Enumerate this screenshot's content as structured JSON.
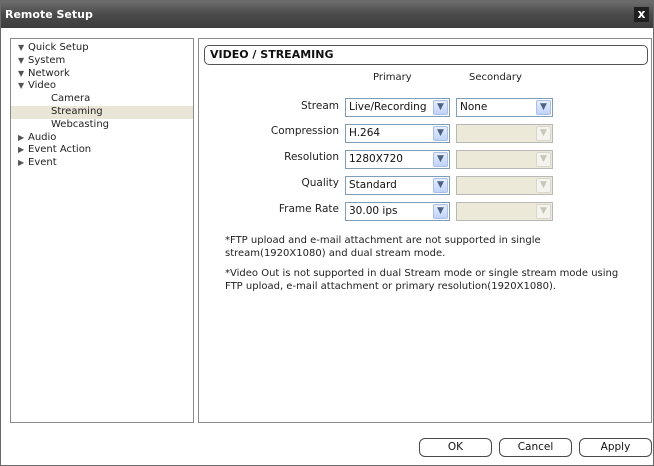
{
  "window": {
    "title": "Remote Setup",
    "close_glyph": "x"
  },
  "tree": {
    "items": [
      {
        "label": "Quick Setup",
        "state": "expanded"
      },
      {
        "label": "System",
        "state": "expanded"
      },
      {
        "label": "Network",
        "state": "expanded"
      },
      {
        "label": "Video",
        "state": "expanded"
      },
      {
        "label": "Camera",
        "state": "child"
      },
      {
        "label": "Streaming",
        "state": "child-selected"
      },
      {
        "label": "Webcasting",
        "state": "child"
      },
      {
        "label": "Audio",
        "state": "collapsed"
      },
      {
        "label": "Event Action",
        "state": "collapsed"
      },
      {
        "label": "Event",
        "state": "collapsed"
      }
    ],
    "expanded_glyph": "▼",
    "collapsed_glyph": "▶"
  },
  "panel": {
    "title": "VIDEO / STREAMING",
    "col_primary": "Primary",
    "col_secondary": "Secondary",
    "rows": [
      {
        "label": "Stream",
        "primary": "Live/Recording",
        "secondary": "None",
        "secondary_enabled": true
      },
      {
        "label": "Compression",
        "primary": "H.264",
        "secondary": "",
        "secondary_enabled": false
      },
      {
        "label": "Resolution",
        "primary": "1280X720",
        "secondary": "",
        "secondary_enabled": false
      },
      {
        "label": "Quality",
        "primary": "Standard",
        "secondary": "",
        "secondary_enabled": false
      },
      {
        "label": "Frame Rate",
        "primary": "30.00 ips",
        "secondary": "",
        "secondary_enabled": false
      }
    ],
    "note1": "*FTP upload and e-mail attachment are not supported in single stream(1920X1080) and dual stream mode.",
    "note2": "*Video Out is not supported in dual Stream mode or single stream mode using FTP upload, e-mail attachment or primary resolution(1920X1080)."
  },
  "buttons": {
    "ok": "OK",
    "cancel": "Cancel",
    "apply": "Apply"
  },
  "icons": {
    "dropdown": "chevron-down-icon",
    "close": "close-icon"
  },
  "colors": {
    "titlebar": "#4a4a4a",
    "selected_row": "#e9e6d8",
    "disabled_field": "#ece9d8"
  }
}
